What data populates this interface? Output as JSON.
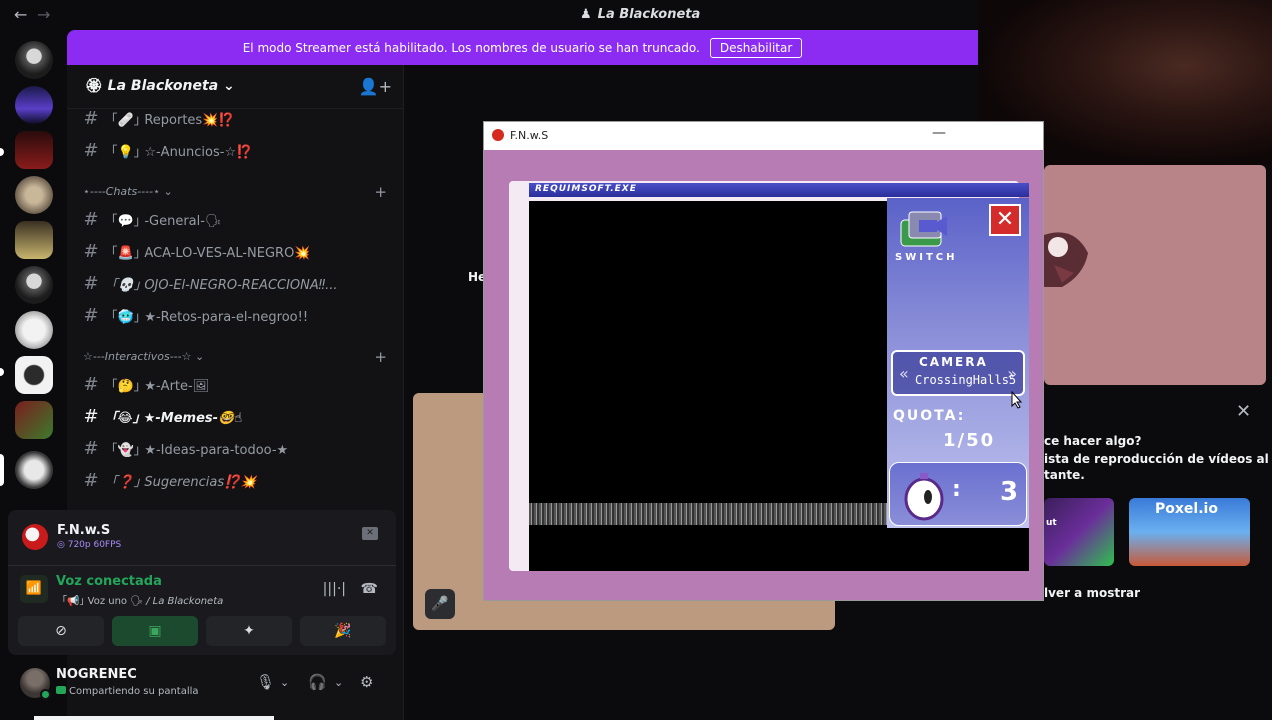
{
  "window": {
    "title": "La Blackoneta",
    "back_arrow": "←",
    "forward_arrow": "→"
  },
  "banner": {
    "message": "El modo Streamer está habilitado. Los nombres de usuario se han truncado.",
    "button": "Deshabilitar"
  },
  "guild": {
    "name": "La Blackoneta",
    "chevron": "⌄"
  },
  "channels": [
    {
      "prefix": "｢🩹｣",
      "label": "Reportes💥⁉️"
    },
    {
      "prefix": "｢💡｣",
      "label": "☆-Anuncios-☆⁉️"
    }
  ],
  "categories": {
    "chats": "⋆----Chats----⋆ ⌄",
    "interactivos": "☆---Interactivos---☆ ⌄"
  },
  "chat_channels": [
    {
      "prefix": "｢💬｣",
      "label": "-General-🗣"
    },
    {
      "prefix": "｢🚨｣",
      "label": "ACA-LO-VES-AL-NEGRO💥"
    },
    {
      "prefix": "｢💀｣",
      "label": "OJO-El-NEGRO-REACCIONA‼..."
    },
    {
      "prefix": "｢🥶｣",
      "label": "★-Retos-para-el-negroo!!"
    }
  ],
  "interactive_channels": [
    {
      "prefix": "｢🤔｣",
      "label": "★-Arte-🖼"
    },
    {
      "prefix": "｢😂｣",
      "label": "★-Memes-🤓☝"
    },
    {
      "prefix": "｢👻｣",
      "label": "★-Ideas-para-todoo-★"
    },
    {
      "prefix": "｢❓｣",
      "label": "Sugerencias⁉️💥"
    }
  ],
  "stream": {
    "title": "F.N.w.S",
    "quality": "720p 60FPS"
  },
  "voice": {
    "status": "Voz conectada",
    "channel": "｢📢｣ Voz uno 🗣",
    "guild": "/ La Blackoneta"
  },
  "user": {
    "name": "NOGRENEC",
    "status": "Compartiendo su pantalla"
  },
  "stage": {
    "partial_text": "He"
  },
  "activity": {
    "question": "ce hacer algo?",
    "desc_line1": "ista de reproducción de vídeos al",
    "desc_line2": "tante.",
    "card1": "ut",
    "card2": "Poxel.io",
    "back": "lver a mostrar"
  },
  "game": {
    "window_title": "F.N.w.S",
    "app_title": "REQUIMSOFT.EXE",
    "switch_label": "SWITCH",
    "camera_label": "CAMERA",
    "camera_name": "CrossingHalls5",
    "quota_label": "QUOTA:",
    "quota_value": "1/50",
    "count": "3"
  },
  "colors": {
    "accent": "#8c2cf2",
    "online": "#23a55a"
  }
}
